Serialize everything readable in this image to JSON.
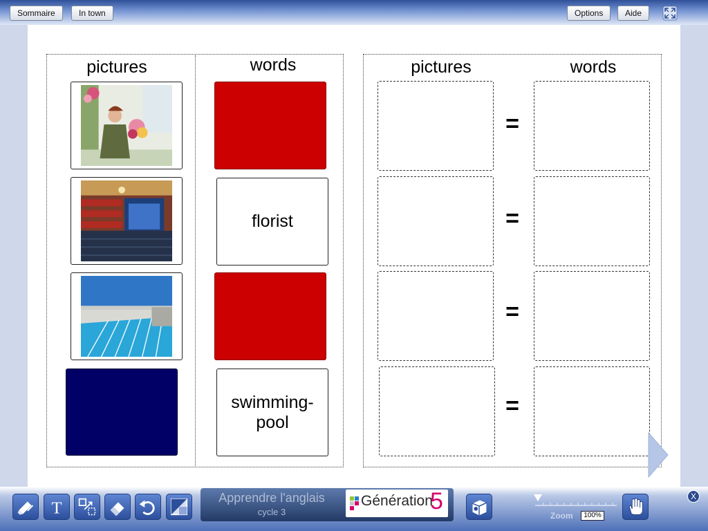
{
  "topbar": {
    "sommaire_label": "Sommaire",
    "in_town_label": "In town",
    "options_label": "Options",
    "aide_label": "Aide",
    "fullscreen_icon": "fullscreen-icon"
  },
  "left_panel": {
    "pictures_header": "pictures",
    "words_header": "words",
    "picture_cards": [
      {
        "icon": "florist-photo"
      },
      {
        "icon": "theatre-photo"
      },
      {
        "icon": "swimming-pool-photo"
      },
      {
        "icon": "blue-card-back",
        "color": "#000066"
      }
    ],
    "word_cards": [
      {
        "text": "",
        "color": "#cc0000"
      },
      {
        "text": "florist"
      },
      {
        "text": "",
        "color": "#cc0000"
      },
      {
        "text": "swimming-pool"
      }
    ]
  },
  "right_panel": {
    "pictures_header": "pictures",
    "words_header": "words",
    "equals": [
      "=",
      "=",
      "=",
      "="
    ]
  },
  "bottombar": {
    "tools": [
      "marker-eraser-icon",
      "text-tool-icon",
      "resize-tool-icon",
      "eraser-icon",
      "undo-icon",
      "mask-tool-icon"
    ],
    "app_title": "Apprendre l'anglais",
    "app_subtitle": "cycle 3",
    "brand_text": "Génération",
    "brand_number": "5",
    "media_icon": "media-box-icon",
    "zoom_label": "Zoom",
    "zoom_value": "100%",
    "hand_icon": "hand-icon",
    "close_label": "X"
  }
}
